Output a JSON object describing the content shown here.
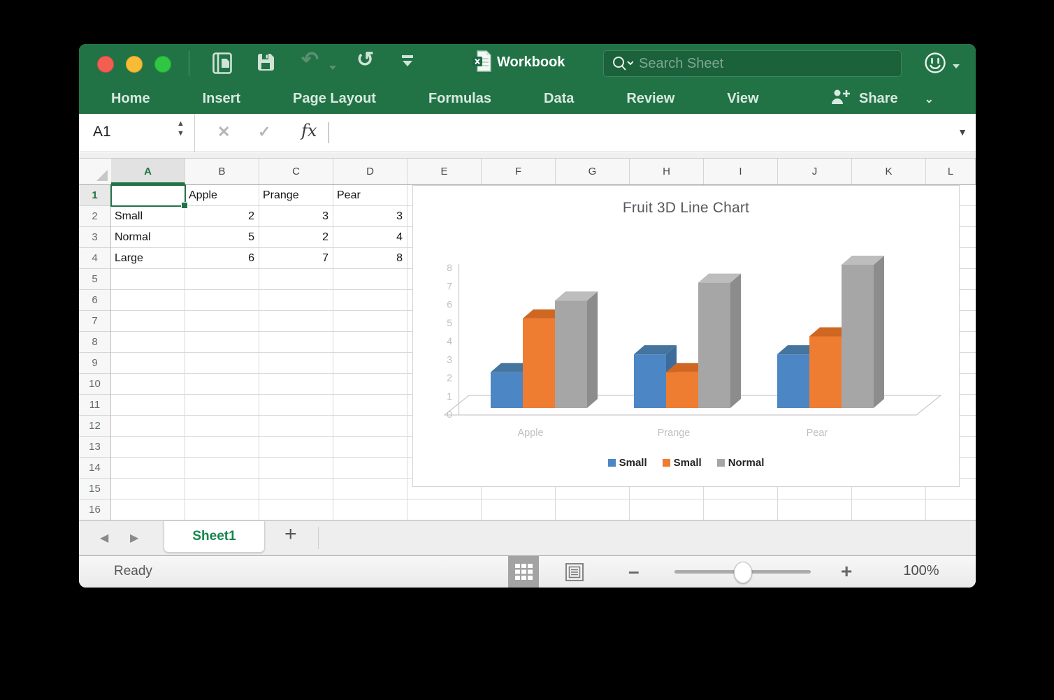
{
  "colors": {
    "accent_green": "#217346",
    "selection_green": "#217346",
    "series_blue": "#4d86c5",
    "series_orange": "#ee7d31",
    "series_gray": "#a6a6a6"
  },
  "titlebar": {
    "title": "Workbook",
    "search_placeholder": "Search Sheet",
    "undo_disabled": true,
    "icons": [
      "new-workbook-icon",
      "save-icon",
      "undo-icon",
      "redo-icon",
      "customize-toolbar-icon",
      "excel-file-icon",
      "search-icon",
      "feedback-smiley-icon"
    ]
  },
  "ribbon": {
    "tabs": [
      "Home",
      "Insert",
      "Page Layout",
      "Formulas",
      "Data",
      "Review",
      "View"
    ],
    "share_label": "Share"
  },
  "formula_bar": {
    "name_box": "A1",
    "fx_label": "fx"
  },
  "grid": {
    "column_headers": [
      "A",
      "B",
      "C",
      "D",
      "E",
      "F",
      "G",
      "H",
      "I",
      "J",
      "K",
      "L"
    ],
    "row_count": 16,
    "selected_column": "A",
    "selected_row": 1,
    "selected_cell": "A1"
  },
  "sheet": {
    "cells": [
      {
        "ref": "B1",
        "value": "Apple",
        "align": "left"
      },
      {
        "ref": "C1",
        "value": "Prange",
        "align": "left"
      },
      {
        "ref": "D1",
        "value": "Pear",
        "align": "left"
      },
      {
        "ref": "A2",
        "value": "Small",
        "align": "left"
      },
      {
        "ref": "B2",
        "value": "2",
        "align": "right"
      },
      {
        "ref": "C2",
        "value": "3",
        "align": "right"
      },
      {
        "ref": "D2",
        "value": "3",
        "align": "right"
      },
      {
        "ref": "A3",
        "value": "Normal",
        "align": "left"
      },
      {
        "ref": "B3",
        "value": "5",
        "align": "right"
      },
      {
        "ref": "C3",
        "value": "2",
        "align": "right"
      },
      {
        "ref": "D3",
        "value": "4",
        "align": "right"
      },
      {
        "ref": "A4",
        "value": "Large",
        "align": "left"
      },
      {
        "ref": "B4",
        "value": "6",
        "align": "right"
      },
      {
        "ref": "C4",
        "value": "7",
        "align": "right"
      },
      {
        "ref": "D4",
        "value": "8",
        "align": "right"
      }
    ]
  },
  "chart_data": {
    "type": "bar",
    "variant": "3d-column",
    "title": "Fruit 3D Line Chart",
    "categories": [
      "Apple",
      "Prange",
      "Pear"
    ],
    "series": [
      {
        "name": "Small",
        "front": "#4d86c5",
        "top": "#45759e",
        "side": "#3d6c9c",
        "values": [
          2,
          3,
          3
        ]
      },
      {
        "name": "Small",
        "front": "#ee7d31",
        "top": "#cf6723",
        "side": "#c2601f",
        "values": [
          5,
          2,
          4
        ]
      },
      {
        "name": "Normal",
        "front": "#a6a6a6",
        "top": "#bdbdbd",
        "side": "#8c8c8c",
        "values": [
          6,
          7,
          8
        ]
      }
    ],
    "ylim": [
      0,
      8
    ],
    "yticks": [
      0,
      1,
      2,
      3,
      4,
      5,
      6,
      7,
      8
    ],
    "grid": false,
    "legend_position": "bottom",
    "axis_label_color": "#bfbfbf"
  },
  "sheet_tabs": {
    "tabs": [
      "Sheet1"
    ],
    "active_tab": "Sheet1",
    "add_tab_label": "+"
  },
  "status_bar": {
    "status": "Ready",
    "zoom_level": "100%"
  }
}
